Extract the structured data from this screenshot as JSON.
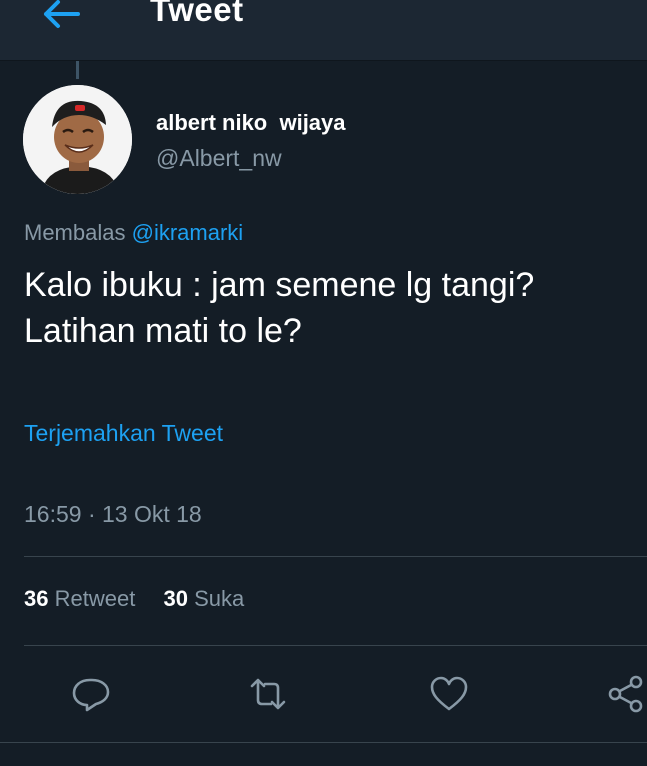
{
  "header": {
    "title": "Tweet",
    "back_icon": "arrow-left-icon"
  },
  "author": {
    "display_name": "albert niko  wijaya",
    "handle": "@Albert_nw"
  },
  "reply": {
    "prefix": "Membalas",
    "to": "@ikramarki"
  },
  "tweet": {
    "lines": [
      "Kalo ibuku : jam semene lg tangi?",
      "Latihan mati to le?"
    ]
  },
  "translate_label": "Terjemahkan Tweet",
  "timestamp": "16:59 · 13 Okt 18",
  "stats": {
    "retweet_count": "36",
    "retweet_label": "Retweet",
    "like_count": "30",
    "like_label": "Suka"
  },
  "actions": [
    "reply-icon",
    "retweet-icon",
    "heart-icon",
    "share-icon"
  ],
  "colors": {
    "background": "#141d26",
    "header_bg": "#1c2733",
    "accent": "#1da1f2",
    "secondary_text": "#8899a6",
    "divider": "#38444d"
  }
}
